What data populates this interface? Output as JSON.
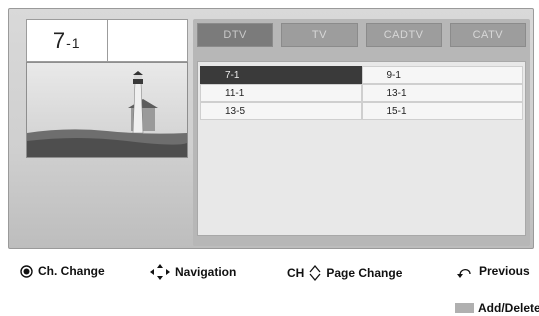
{
  "current_channel": {
    "number": "7",
    "sub": "-1"
  },
  "tabs": [
    {
      "label": "DTV",
      "active": true
    },
    {
      "label": "TV",
      "active": false
    },
    {
      "label": "CADTV",
      "active": false
    },
    {
      "label": "CATV",
      "active": false
    }
  ],
  "channels": {
    "left": [
      "7-1",
      "11-1",
      "13-5"
    ],
    "right": [
      "9-1",
      "13-1",
      "15-1"
    ],
    "selected": "7-1"
  },
  "hints": {
    "ch_change": "Ch. Change",
    "navigation": "Navigation",
    "ch_prefix": "CH",
    "page_change": "Page Change",
    "previous": "Previous",
    "add_delete": "Add/Delete"
  },
  "colors": {
    "selected_bg": "#3a3a3a",
    "panel_bg": "#d4d4d4",
    "tab_bg": "#9d9d9d"
  },
  "icons": {
    "ch_change": "ok-button-icon",
    "navigation": "four-way-arrows-icon",
    "page_change": "up-down-chevron-icon",
    "previous": "back-return-icon",
    "add_delete": "gray-color-key-icon"
  }
}
